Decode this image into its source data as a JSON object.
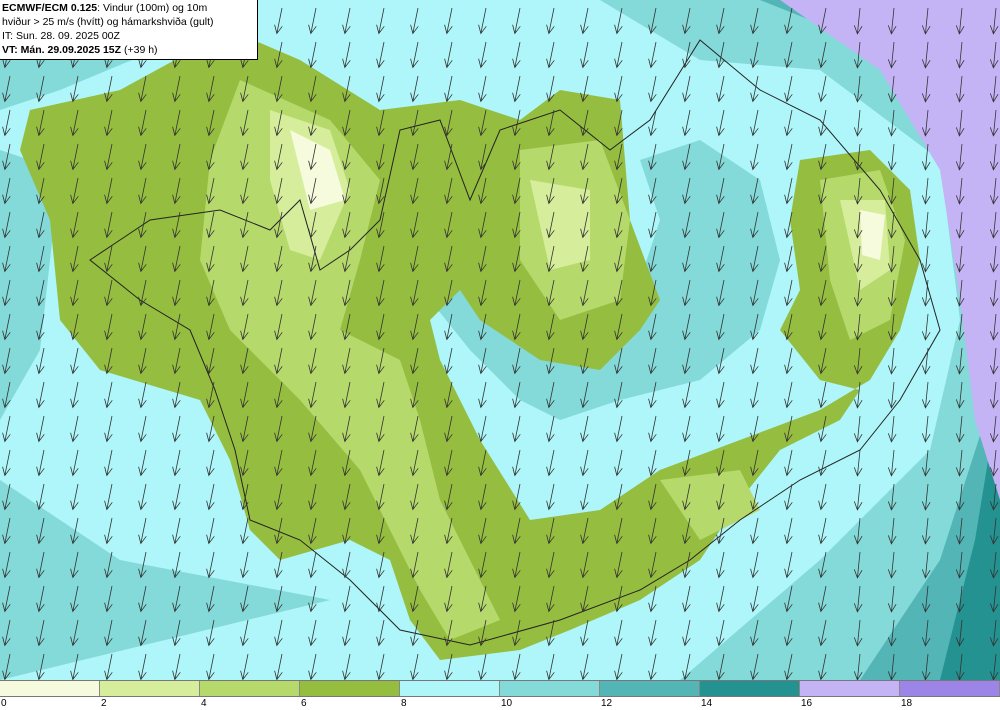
{
  "title": {
    "model": "ECMWF/ECM 0.125",
    "line1_rest": ": Vindur (100m) og 10m",
    "line2": "hviður > 25 m/s (hvítt) og hámarkshviða (gult)",
    "line3": "IT: Sun. 28. 09. 2025 00Z",
    "vt": "VT: Mán. 29.09.2025 15Z",
    "lead": " (+39 h)"
  },
  "legend": {
    "unit": "m/s",
    "bins": [
      {
        "from": 0,
        "to": 2,
        "color": "#f5fbdc"
      },
      {
        "from": 2,
        "to": 4,
        "color": "#d6ed9c"
      },
      {
        "from": 4,
        "to": 6,
        "color": "#b6d96c"
      },
      {
        "from": 6,
        "to": 8,
        "color": "#95bd3f"
      },
      {
        "from": 8,
        "to": 10,
        "color": "#aef6f9"
      },
      {
        "from": 10,
        "to": 12,
        "color": "#84d9d9"
      },
      {
        "from": 12,
        "to": 14,
        "color": "#53b5b6"
      },
      {
        "from": 14,
        "to": 16,
        "color": "#249290"
      },
      {
        "from": 16,
        "to": 18,
        "color": "#c4b4f6"
      },
      {
        "from": 18,
        "to": null,
        "color": "#9c85e6"
      }
    ],
    "tick_labels": [
      "0",
      "2",
      "4",
      "6",
      "8",
      "10",
      "12",
      "14",
      "16",
      "18"
    ]
  },
  "map": {
    "region": "Iceland",
    "wind_direction": "northerly",
    "arrow_icon": "wind-arrow-icon"
  }
}
